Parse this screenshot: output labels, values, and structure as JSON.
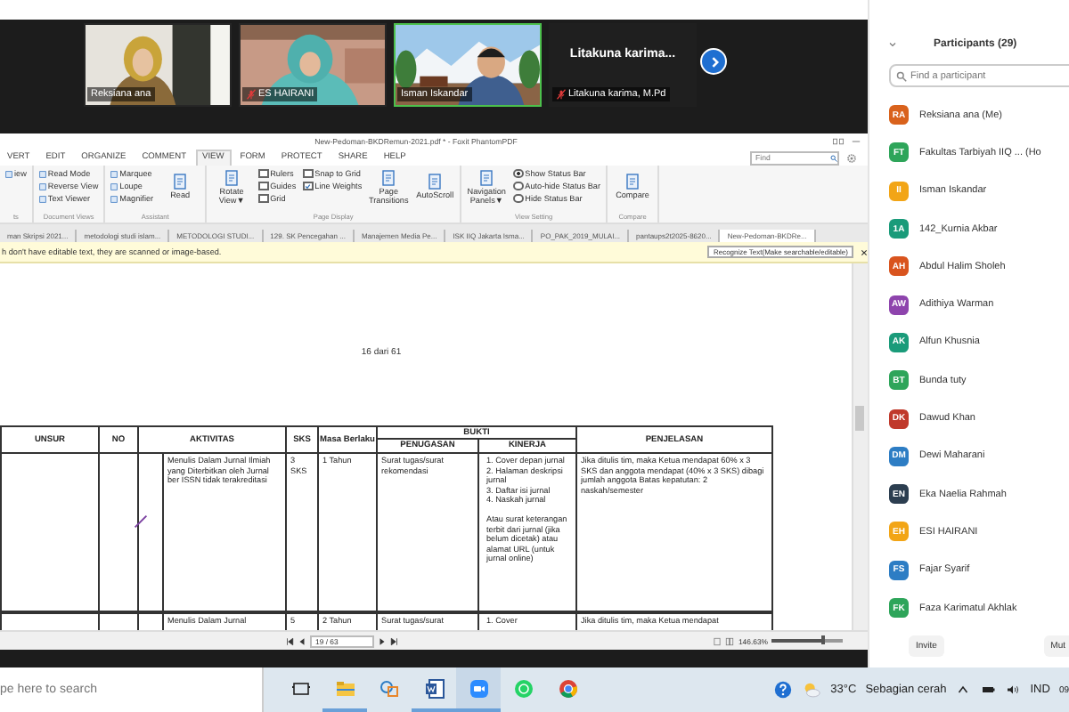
{
  "meeting": {
    "tiles": [
      {
        "kind": "video",
        "name": "Reksiana ana",
        "muted": false,
        "speaking": false
      },
      {
        "kind": "video",
        "name": "ES  HAIRANI",
        "muted": true,
        "speaking": false
      },
      {
        "kind": "video",
        "name": "Isman Iskandar",
        "muted": false,
        "speaking": true
      },
      {
        "kind": "name",
        "display": "Litakuna  karima...",
        "name": "Litakuna karima, M.Pd",
        "muted": true,
        "speaking": false
      }
    ]
  },
  "pdf_viewer": {
    "title": "New-Pedoman-BKDRemun-2021.pdf * - Foxit PhantomPDF",
    "menu_tabs": [
      {
        "label": "VERT",
        "selected": false
      },
      {
        "label": "EDIT",
        "selected": false
      },
      {
        "label": "ORGANIZE",
        "selected": false
      },
      {
        "label": "COMMENT",
        "selected": false
      },
      {
        "label": "VIEW",
        "selected": true
      },
      {
        "label": "FORM",
        "selected": false
      },
      {
        "label": "PROTECT",
        "selected": false
      },
      {
        "label": "SHARE",
        "selected": false
      },
      {
        "label": "HELP",
        "selected": false
      }
    ],
    "find": {
      "placeholder": "Find"
    },
    "ribbon": [
      {
        "label": "ts",
        "items": [
          {
            "kind": "small",
            "text": "iew"
          }
        ]
      },
      {
        "label": "Document Views",
        "items": [
          {
            "kind": "small",
            "text": "Read Mode"
          },
          {
            "kind": "small",
            "text": "Reverse View"
          },
          {
            "kind": "small",
            "text": "Text Viewer"
          }
        ]
      },
      {
        "label": "Assistant",
        "items": [
          {
            "kind": "small",
            "text": "Marquee"
          },
          {
            "kind": "small",
            "text": "Loupe"
          },
          {
            "kind": "small",
            "text": "Magnifier"
          },
          {
            "kind": "large",
            "text": "Read"
          }
        ]
      },
      {
        "label": "Page Display",
        "items": [
          {
            "kind": "large",
            "text": "Rotate View▼"
          },
          {
            "kind": "check",
            "text": "Rulers",
            "checked": false
          },
          {
            "kind": "check",
            "text": "Guides",
            "checked": false
          },
          {
            "kind": "check",
            "text": "Grid",
            "checked": false
          },
          {
            "kind": "check",
            "text": "Snap to Grid",
            "checked": false
          },
          {
            "kind": "check",
            "text": "Line Weights",
            "checked": true
          },
          {
            "kind": "large",
            "text": "Page Transitions"
          },
          {
            "kind": "large",
            "text": "AutoScroll"
          }
        ]
      },
      {
        "label": "View Setting",
        "items": [
          {
            "kind": "large",
            "text": "Navigation Panels▼"
          },
          {
            "kind": "radio",
            "text": "Show Status Bar",
            "selected": true
          },
          {
            "kind": "radio",
            "text": "Auto-hide Status Bar",
            "selected": false
          },
          {
            "kind": "radio",
            "text": "Hide Status Bar",
            "selected": false
          }
        ]
      },
      {
        "label": "Compare",
        "items": [
          {
            "kind": "large",
            "text": "Compare"
          }
        ]
      }
    ],
    "doc_tabs": [
      {
        "label": "man Skripsi 2021...",
        "selected": false
      },
      {
        "label": "metodologi studi islam...",
        "selected": false
      },
      {
        "label": "METODOLOGI STUDI...",
        "selected": false
      },
      {
        "label": "129. SK Pencegahan ...",
        "selected": false
      },
      {
        "label": "Manajemen Media Pe...",
        "selected": false
      },
      {
        "label": "ISK IIQ Jakarta Isma...",
        "selected": false
      },
      {
        "label": "PO_PAK_2019_MULAI...",
        "selected": false
      },
      {
        "label": "pantaups2t2025-8620...",
        "selected": false
      },
      {
        "label": "New-Pedoman-BKDRe...",
        "selected": true
      }
    ],
    "notice": {
      "text": "h don't have editable text, they are scanned or image-based.",
      "button": "Recognize Text(Make searchable/editable)"
    },
    "page_label": "16 dari 61",
    "table": {
      "group_header": "BUKTI",
      "headers": [
        "UNSUR",
        "NO",
        "AKTIVITAS",
        "SKS",
        "Masa Berlaku",
        "PENUGASAN",
        "KINERJA",
        "PENJELASAN"
      ],
      "rows": [
        {
          "unsur": "",
          "no": "",
          "aktivitas": "Menulis Dalam Jurnal Ilmiah yang Diterbitkan oleh Jurnal ber ISSN tidak terakreditasi",
          "sks": "3 SKS",
          "masa": "1 Tahun",
          "penugasan": "Surat tugas/surat rekomendasi",
          "kinerja": [
            "1. Cover depan jurnal",
            "2. Halaman deskripsi jurnal",
            "3. Daftar isi jurnal",
            "4. Naskah jurnal"
          ],
          "kinerja_note": "Atau surat keterangan terbit dari jurnal (jika belum dicetak) atau alamat URL (untuk jurnal online)",
          "penjelasan": "Jika ditulis tim, maka Ketua mendapat 60% x 3 SKS dan anggota mendapat (40% x 3 SKS) dibagi jumlah anggota Batas kepatutan: 2 naskah/semester"
        },
        {
          "unsur": "",
          "no": "",
          "aktivitas": "Menulis Dalam Jurnal",
          "sks": "5",
          "masa": "2 Tahun",
          "penugasan": "Surat tugas/surat",
          "kinerja": [
            "1. Cover"
          ],
          "kinerja_note": "",
          "penjelasan": "Jika ditulis tim, maka Ketua mendapat"
        }
      ]
    },
    "status": {
      "page": "19 / 63",
      "zoom": "146.63%",
      "zoom_slider": {
        "level": 0.72
      }
    }
  },
  "participants": {
    "title": "Participants (29)",
    "search": {
      "placeholder": "Find a participant"
    },
    "items": [
      {
        "initials": "RA",
        "name": "Reksiana ana (Me)",
        "color": "#d9621c"
      },
      {
        "initials": "FT",
        "name": "Fakultas Tarbiyah IIQ ... (Ho",
        "color": "#2ea55a"
      },
      {
        "initials": "II",
        "name": "Isman Iskandar",
        "color": "#f2a516"
      },
      {
        "initials": "1A",
        "name": "142_Kurnia Akbar",
        "color": "#1a9b7a"
      },
      {
        "initials": "AH",
        "name": "Abdul Halim Sholeh",
        "color": "#d9541e"
      },
      {
        "initials": "AW",
        "name": "Adithiya Warman",
        "color": "#8e44ad"
      },
      {
        "initials": "AK",
        "name": "Alfun Khusnia",
        "color": "#1a9b7a"
      },
      {
        "initials": "BT",
        "name": "Bunda tuty",
        "color": "#2ea55a"
      },
      {
        "initials": "DK",
        "name": "Dawud Khan",
        "color": "#c0392b"
      },
      {
        "initials": "DM",
        "name": "Dewi Maharani",
        "color": "#2d7dc4"
      },
      {
        "initials": "EN",
        "name": "Eka Naelia Rahmah",
        "color": "#2c3e50"
      },
      {
        "initials": "EH",
        "name": "ESI HAIRANI",
        "color": "#f2a516"
      },
      {
        "initials": "FS",
        "name": "Fajar Syarif",
        "color": "#2d7dc4"
      },
      {
        "initials": "FK",
        "name": "Faza Karimatul Akhlak",
        "color": "#2ea55a"
      }
    ],
    "buttons": [
      "Invite",
      "Mut"
    ]
  },
  "taskbar": {
    "search": {
      "placeholder": "pe here to search"
    },
    "apps": [
      {
        "kind": "taskview",
        "running": false,
        "selected": false
      },
      {
        "kind": "explorer",
        "running": true,
        "selected": false
      },
      {
        "kind": "shapes",
        "running": false,
        "selected": false
      },
      {
        "kind": "word",
        "running": true,
        "selected": false
      },
      {
        "kind": "zoom",
        "running": true,
        "selected": true
      },
      {
        "kind": "whatsapp",
        "running": false,
        "selected": false
      },
      {
        "kind": "chrome",
        "running": false,
        "selected": false
      }
    ],
    "temperature": "33°C",
    "weather": "Sebagian cerah",
    "language": "IND",
    "clock": "09"
  }
}
